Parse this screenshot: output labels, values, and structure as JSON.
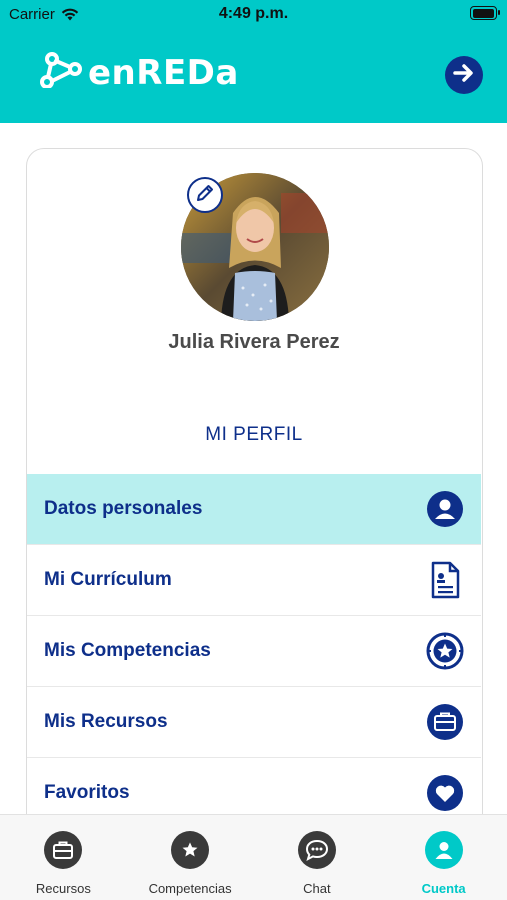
{
  "status_bar": {
    "carrier": "Carrier",
    "time": "4:49 p.m.",
    "battery_level": 0.95
  },
  "header": {
    "logo_text": "enREDa",
    "logo_icon": "network-nodes-icon",
    "logout_icon": "arrow-right-icon"
  },
  "profile": {
    "name": "Julia Rivera Perez",
    "avatar_icon": "user-photo",
    "edit_icon": "pencil-icon",
    "section_title": "MI PERFIL"
  },
  "menu": {
    "items": [
      {
        "label": "Datos personales",
        "icon": "person-icon",
        "active": true
      },
      {
        "label": "Mi Currículum",
        "icon": "document-icon",
        "active": false
      },
      {
        "label": "Mis Competencias",
        "icon": "star-badge-icon",
        "active": false
      },
      {
        "label": "Mis Recursos",
        "icon": "briefcase-icon",
        "active": false
      },
      {
        "label": "Favoritos",
        "icon": "heart-icon",
        "active": false
      }
    ]
  },
  "tabbar": {
    "tabs": [
      {
        "label": "Recursos",
        "icon": "briefcase-icon",
        "active": false
      },
      {
        "label": "Competencias",
        "icon": "star-icon",
        "active": false
      },
      {
        "label": "Chat",
        "icon": "chat-icon",
        "active": false
      },
      {
        "label": "Cuenta",
        "icon": "person-icon",
        "active": true
      }
    ]
  },
  "colors": {
    "accent": "#00c9c8",
    "navy": "#0e2f8a",
    "active_row": "#b8efef"
  }
}
